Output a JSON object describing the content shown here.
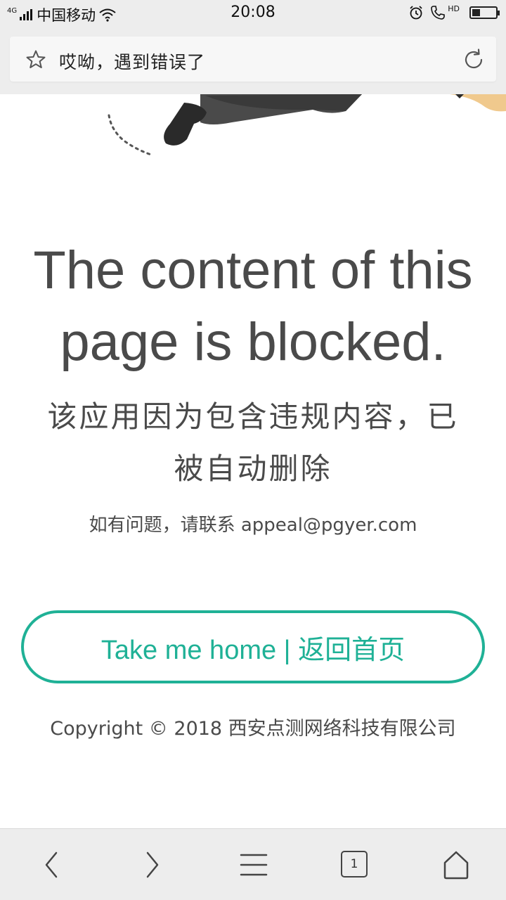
{
  "status_bar": {
    "network_type": "4G",
    "carrier": "中国移动",
    "time": "20:08",
    "hd_label": "HD",
    "battery_level": 0.35
  },
  "address_bar": {
    "title": "哎呦，遇到错误了"
  },
  "main": {
    "headline_line1": "The content of this",
    "headline_line2": "page is blocked.",
    "subheadline_line1": "该应用因为包含违规内容，已",
    "subheadline_line2": "被自动删除",
    "contact_text": "如有问题，请联系 appeal@pgyer.com",
    "home_button_label": "Take me home | 返回首页",
    "copyright": "Copyright © 2018 西安点测网络科技有限公司"
  },
  "bottom_bar": {
    "tab_count": "1"
  },
  "colors": {
    "accent": "#1fb196",
    "text": "#4a4a4a",
    "chrome_bg": "#ededed"
  },
  "icons": [
    "wifi-icon",
    "alarm-icon",
    "phone-icon",
    "battery-icon",
    "star-icon",
    "reload-icon",
    "back-icon",
    "forward-icon",
    "menu-icon",
    "tabs-icon",
    "home-icon"
  ]
}
